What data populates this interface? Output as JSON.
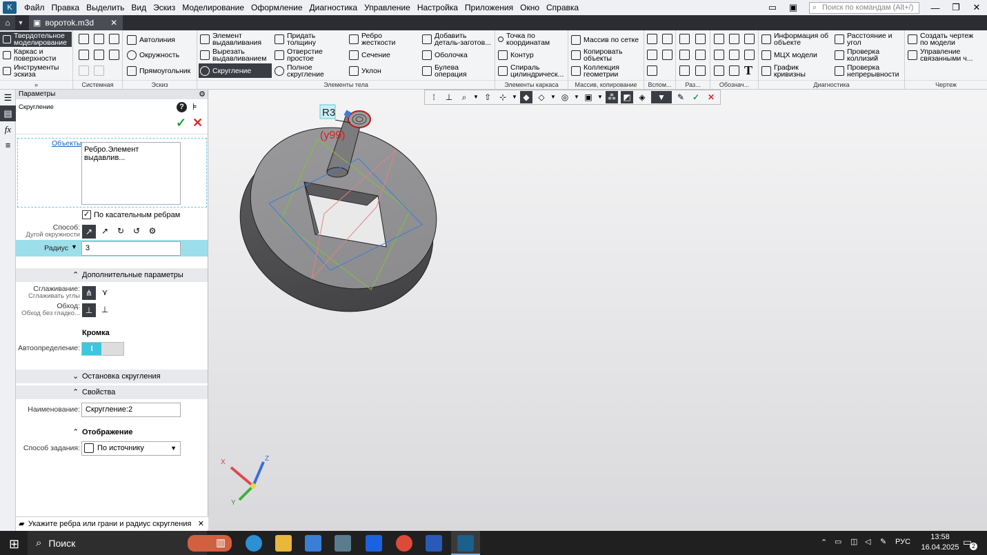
{
  "menu": {
    "items": [
      "Файл",
      "Правка",
      "Выделить",
      "Вид",
      "Эскиз",
      "Моделирование",
      "Оформление",
      "Диагностика",
      "Управление",
      "Настройка",
      "Приложения",
      "Окно",
      "Справка"
    ],
    "search_placeholder": "Поиск по командам (Alt+/)"
  },
  "tabs": {
    "active": "воротоk.m3d"
  },
  "ribbon": {
    "modes": [
      "Твердотельное моделирование",
      "Каркас и поверхности",
      "Инструменты эскиза"
    ],
    "groups": {
      "system": "Системная",
      "sketch": "Эскиз",
      "body": "Элементы тела",
      "frame": "Элементы каркаса",
      "array": "Массив, копирование",
      "aux": "Вспом...",
      "parts": "Раз...",
      "notes": "Обознач...",
      "diag": "Диагностика",
      "drawing": "Чертеж"
    },
    "sketch_items": [
      "Автолиния",
      "Окружность",
      "Прямоугольник"
    ],
    "body_items": [
      "Элемент выдавливания",
      "Вырезать выдавливанием",
      "Скругление",
      "Придать толщину",
      "Отверстие простое",
      "Полное скругление",
      "Ребро жесткости",
      "Сечение",
      "Уклон",
      "Добавить деталь-заготов...",
      "Оболочка",
      "Булева операция"
    ],
    "frame_items": [
      "Точка по координатам",
      "Контур",
      "Спираль цилиндрическ..."
    ],
    "array_items": [
      "Массив по сетке",
      "Копировать объекты",
      "Коллекция геометрии"
    ],
    "diag_items": [
      "Информация об объекте",
      "МЦХ модели",
      "График кривизны",
      "Расстояние и угол",
      "Проверка коллизий",
      "Проверка непрерывности"
    ],
    "drawing_items": [
      "Создать чертеж по модели",
      "Управление связанными ч..."
    ]
  },
  "panel": {
    "header": "Параметры",
    "command": "Скругление",
    "objects_label": "Объекты",
    "objects_value": "Ребро.Элемент выдавлив...",
    "tangent_label": "По касательным ребрам",
    "tangent_checked": true,
    "method_label": "Способ:",
    "method_sub": "Дугой окружности",
    "radius_label": "Радиус",
    "radius_value": "3",
    "extra_section": "Дополнительные параметры",
    "smooth_label": "Сглаживание:",
    "smooth_sub": "Сглаживать углы",
    "bypass_label": "Обход:",
    "bypass_sub": "Обход без гладко...",
    "edge_title": "Кромка",
    "auto_label": "Автоопределение:",
    "stop_section": "Остановка скругления",
    "props_section": "Свойства",
    "name_label": "Наименование:",
    "name_value": "Скругление:2",
    "display_title": "Отображение",
    "mode_label": "Способ задания:",
    "mode_value": "По источнику"
  },
  "viewport": {
    "dim_label": "R3",
    "dim_sub": "(у99)",
    "axes": [
      "X",
      "Y",
      "Z"
    ]
  },
  "status": {
    "hint": "Укажите ребра или грани и радиус скругления"
  },
  "taskbar": {
    "search": "Поиск",
    "lang": "РУС",
    "time": "13:58",
    "date": "16.04.2025",
    "notif": "2"
  },
  "colors": {
    "accent": "#3ec6e0",
    "dark": "#3a3d44",
    "ok": "#1a9e3a",
    "cancel": "#d92c2c"
  }
}
